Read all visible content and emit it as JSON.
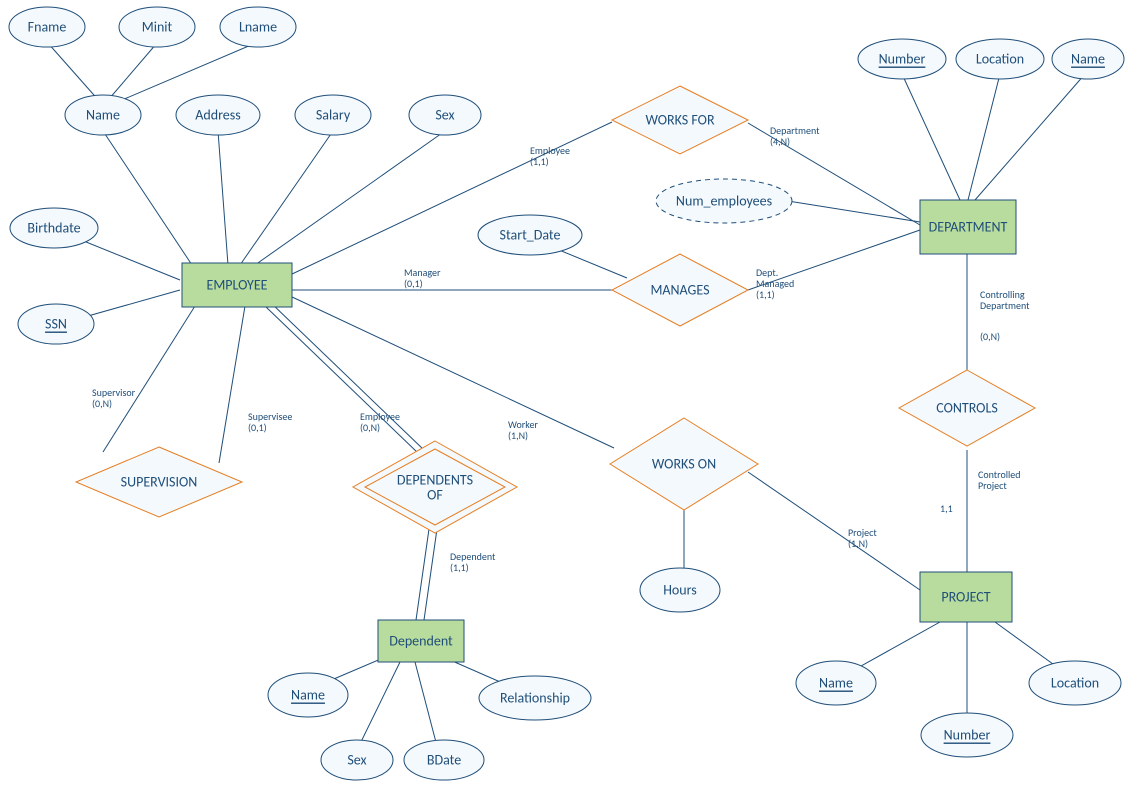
{
  "entities": {
    "employee": "EMPLOYEE",
    "department": "DEPARTMENT",
    "project": "PROJECT",
    "dependent": "Dependent"
  },
  "relationships": {
    "works_for": "WORKS FOR",
    "manages": "MANAGES",
    "controls": "CONTROLS",
    "works_on": "WORKS ON",
    "supervision": "SUPERVISION",
    "dependents_of": "DEPENDENTS OF"
  },
  "attributes": {
    "fname": "Fname",
    "minit": "Minit",
    "lname": "Lname",
    "name": "Name",
    "address": "Address",
    "salary": "Salary",
    "sex": "Sex",
    "birthdate": "Birthdate",
    "ssn": "SSN",
    "num_employees": "Num_employees",
    "start_date": "Start_Date",
    "hours": "Hours",
    "dept_number": "Number",
    "dept_location": "Location",
    "dept_name": "Name",
    "proj_name": "Name",
    "proj_number": "Number",
    "proj_location": "Location",
    "dep_name": "Name",
    "dep_sex": "Sex",
    "dep_bdate": "BDate",
    "dep_relationship": "Relationship"
  },
  "roles": {
    "wf_employee": "Employee\n(1,1)",
    "wf_department": "Department\n(4,N)",
    "mg_manager": "Manager\n(0,1)",
    "mg_dept": "Dept.\nManaged\n(1,1)",
    "ct_dept": "Controlling\nDepartment",
    "ct_dept_card": "(0,N)",
    "ct_proj": "Controlled\nProject",
    "ct_proj_card": "1,1",
    "wo_worker": "Worker\n(1,N)",
    "wo_project": "Project\n(1,N)",
    "sv_supervisor": "Supervisor\n(0,N)",
    "sv_supervisee": "Supervisee\n(0,1)",
    "do_employee": "Employee\n(0,N)",
    "do_dependent": "Dependent\n(1,1)"
  }
}
